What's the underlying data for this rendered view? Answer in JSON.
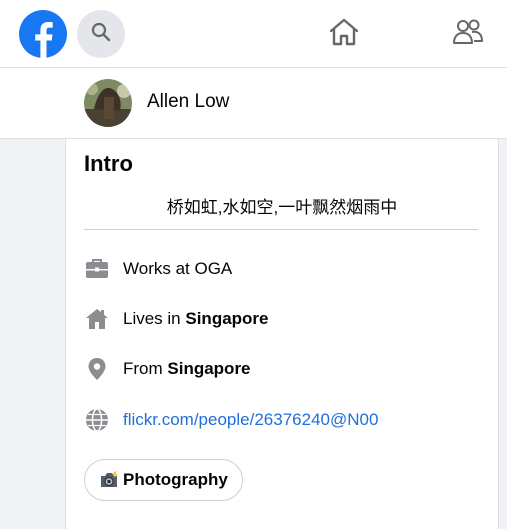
{
  "nav": {
    "logo_icon": "facebook-logo-icon",
    "search_icon": "search-icon",
    "home_icon": "home-icon",
    "friends_icon": "friends-icon",
    "brand_color": "#1877f2"
  },
  "profile": {
    "name": "Allen Low"
  },
  "intro": {
    "title": "Intro",
    "bio": "桥如虹,水如空,一叶飘然烟雨中",
    "work": {
      "prefix": "Works at OGA",
      "icon": "briefcase-icon"
    },
    "lives": {
      "prefix": "Lives in ",
      "place": "Singapore",
      "icon": "house-icon"
    },
    "from": {
      "prefix": "From ",
      "place": "Singapore",
      "icon": "location-pin-icon"
    },
    "website": {
      "url": "flickr.com/people/26376240@N00",
      "icon": "globe-icon"
    },
    "hobby": {
      "label": "Photography",
      "icon": "camera-flash-icon"
    }
  }
}
